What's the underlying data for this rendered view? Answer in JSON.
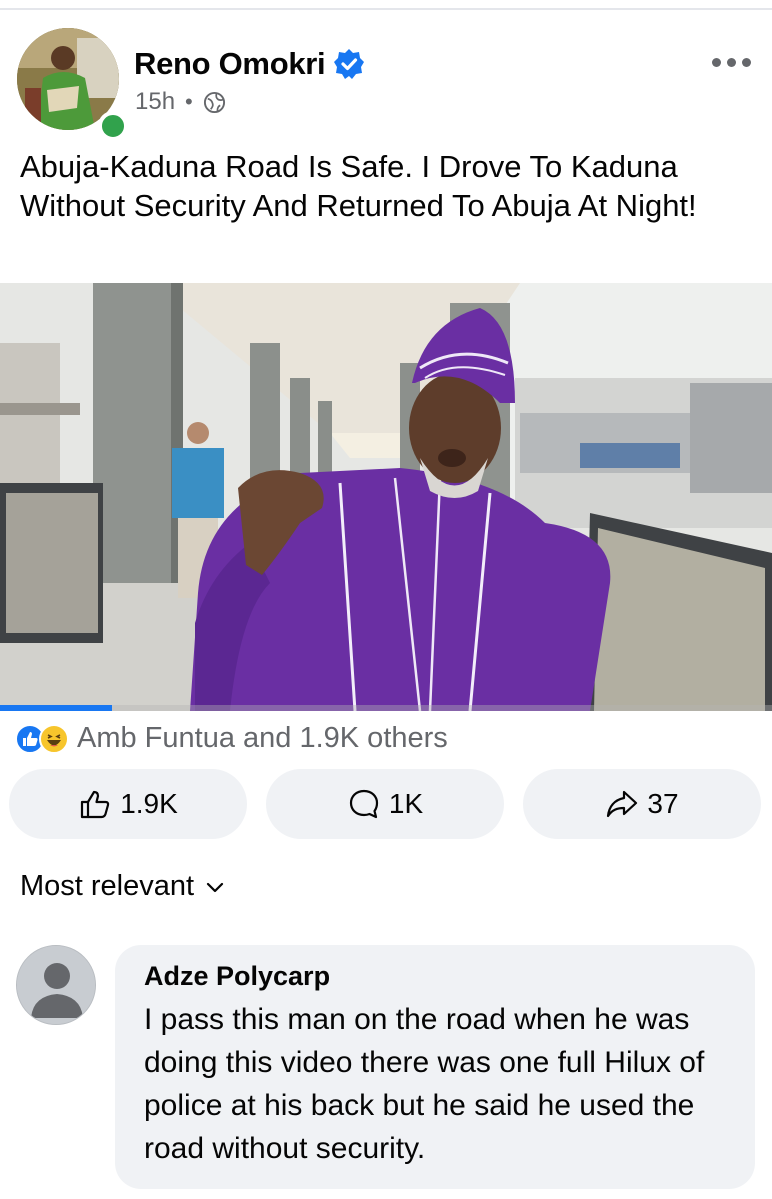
{
  "post": {
    "author": "Reno Omokri",
    "time": "15h",
    "separator": "•",
    "text": "Abuja-Kaduna Road Is Safe. I Drove To Kaduna Without Security And Returned To Abuja At Night!",
    "video_progress": 0.145
  },
  "reactions": {
    "summary": "Amb Funtua and 1.9K others",
    "icons": [
      "like-icon",
      "haha-icon"
    ]
  },
  "actions": {
    "like_count": "1.9K",
    "comment_count": "1K",
    "share_count": "37"
  },
  "sort": {
    "label": "Most relevant"
  },
  "comment": {
    "author": "Adze Polycarp",
    "text": "I pass this man on the road when he was doing this video there was one full Hilux of police at his back but he said he used the road without security."
  },
  "colors": {
    "accent": "#1877f2",
    "online": "#31a24c",
    "muted_text": "#65676b",
    "button_bg": "#f0f2f5",
    "agbada_purple": "#6a2fa3"
  }
}
